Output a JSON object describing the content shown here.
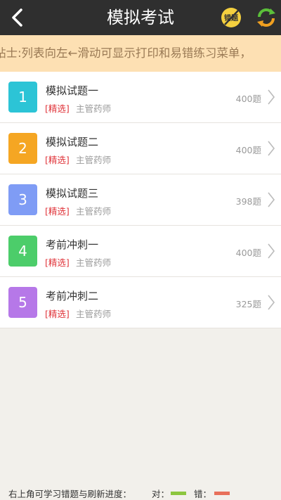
{
  "header": {
    "title": "模拟考试",
    "wrong_icon_text": "错题"
  },
  "tip": {
    "text": "贴士:列表向左←滑动可显示打印和易错练习菜单，"
  },
  "exams": [
    {
      "number": "1",
      "title": "模拟试题一",
      "tag": "[精选]",
      "category": "主管药师",
      "count": "400题",
      "color": "#2cc4d6"
    },
    {
      "number": "2",
      "title": "模拟试题二",
      "tag": "[精选]",
      "category": "主管药师",
      "count": "400题",
      "color": "#f5a623"
    },
    {
      "number": "3",
      "title": "模拟试题三",
      "tag": "[精选]",
      "category": "主管药师",
      "count": "398题",
      "color": "#7f9cf5"
    },
    {
      "number": "4",
      "title": "考前冲刺一",
      "tag": "[精选]",
      "category": "主管药师",
      "count": "400题",
      "color": "#4ccd6a"
    },
    {
      "number": "5",
      "title": "考前冲刺二",
      "tag": "[精选]",
      "category": "主管药师",
      "count": "325题",
      "color": "#b678e8"
    }
  ],
  "footer": {
    "text": "右上角可学习错题与刷新进度：",
    "correct_label": "对：",
    "wrong_label": "错：",
    "correct_color": "#8dc63f",
    "wrong_color": "#e8705a"
  }
}
